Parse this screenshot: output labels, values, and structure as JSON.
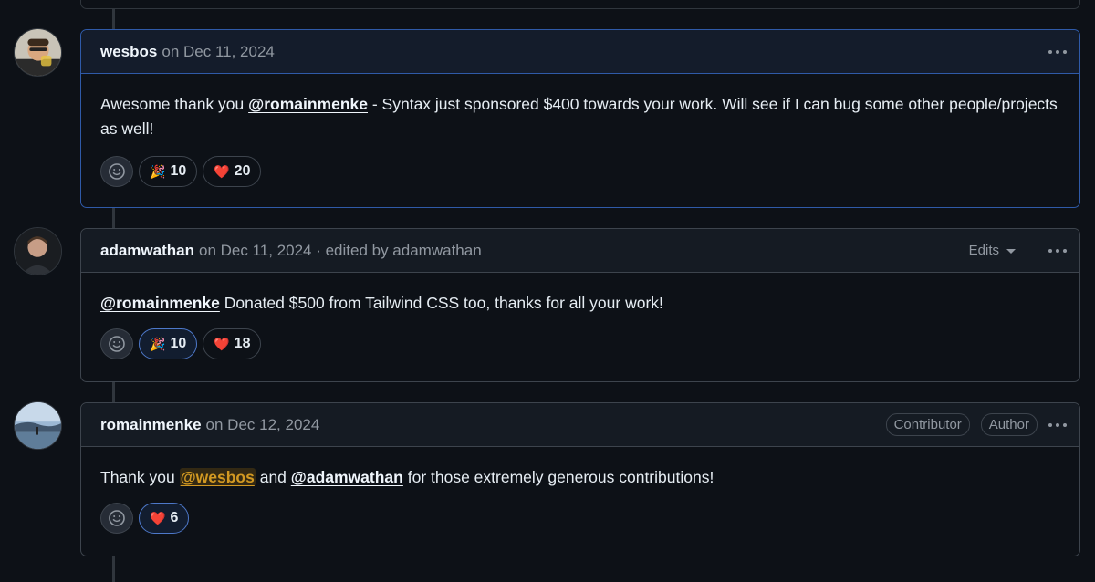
{
  "comments": [
    {
      "author": "wesbos",
      "meta": "on Dec 11, 2024",
      "body": {
        "text1": "Awesome thank you ",
        "mention": "@romainmenke",
        "text2": " - Syntax just sponsored $400 towards your work. Will see if I can bug some other people/projects as well!"
      },
      "reactions": [
        {
          "icon": "party-popper-icon",
          "emoji": "🎉",
          "count": "10",
          "active": false
        },
        {
          "icon": "heart-icon",
          "emoji": "❤️",
          "count": "20",
          "active": false
        }
      ]
    },
    {
      "author": "adamwathan",
      "meta": "on Dec 11, 2024 · edited by adamwathan",
      "edits_label": "Edits",
      "body": {
        "mention": "@romainmenke",
        "text": " Donated $500 from Tailwind CSS too, thanks for all your work!"
      },
      "reactions": [
        {
          "icon": "party-popper-icon",
          "emoji": "🎉",
          "count": "10",
          "active": true
        },
        {
          "icon": "heart-icon",
          "emoji": "❤️",
          "count": "18",
          "active": false
        }
      ]
    },
    {
      "author": "romainmenke",
      "meta": "on Dec 12, 2024",
      "badges": [
        "Contributor",
        "Author"
      ],
      "body": {
        "text1": "Thank you ",
        "mention1": "@wesbos",
        "text2": " and ",
        "mention2": "@adamwathan",
        "text3": " for those extremely generous contributions!"
      },
      "reactions": [
        {
          "icon": "heart-icon",
          "emoji": "❤️",
          "count": "6",
          "active": true
        }
      ]
    }
  ],
  "colors": {
    "background": "#0d1117",
    "highlight_border": "#2f5aa8",
    "self_mention": "#d29922",
    "heart": "#f85149"
  }
}
